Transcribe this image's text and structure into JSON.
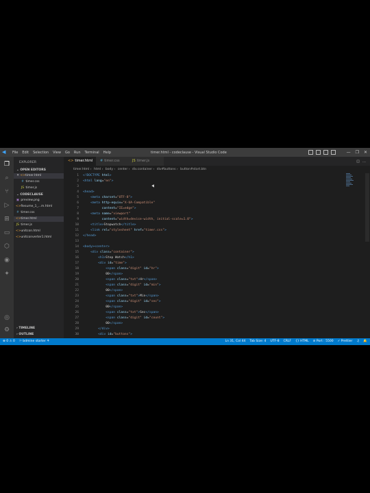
{
  "titlebar": {
    "menu": [
      "File",
      "Edit",
      "Selection",
      "View",
      "Go",
      "Run",
      "Terminal",
      "Help"
    ],
    "title": "timer.html - codeclause - Visual Studio Code",
    "controls": [
      "—",
      "❐",
      "✕"
    ]
  },
  "sidebar": {
    "title": "EXPLORER",
    "open_editors_label": "OPEN EDITORS",
    "open_editors": [
      {
        "name": "timer.html",
        "icon": "html-file-icon",
        "close": "✕"
      },
      {
        "name": "timer.css",
        "icon": "css-file-icon"
      },
      {
        "name": "timer.js",
        "icon": "js-file-icon"
      }
    ],
    "workspace_label": "CODECLAUSE",
    "files": [
      {
        "name": "preview.png",
        "icon": "image-file-icon"
      },
      {
        "name": "Resume_1_...m.html",
        "icon": "html-file-icon"
      },
      {
        "name": "timer.css",
        "icon": "css-file-icon"
      },
      {
        "name": "timer.html",
        "icon": "html-file-icon"
      },
      {
        "name": "timer.js",
        "icon": "js-file-icon"
      },
      {
        "name": "unitcon.html",
        "icon": "html-file-icon"
      },
      {
        "name": "unitconverter1.html",
        "icon": "html-file-icon"
      }
    ],
    "timeline_label": "TIMELINE",
    "outline_label": "OUTLINE"
  },
  "tabs": [
    {
      "label": "timer.html",
      "close": "✕",
      "active": true
    },
    {
      "label": "timer.css",
      "active": false
    },
    {
      "label": "timer.js",
      "active": false
    }
  ],
  "breadcrumb": [
    "timer.html",
    "html",
    "body",
    "center",
    "div.container",
    "div#buttons",
    "button#start.btn"
  ],
  "code_lines": [
    {
      "n": "1",
      "h": "<span class=\"tag\">&lt;!DOCTYPE</span> <span class=\"attr\">html</span><span class=\"tag\">&gt;</span>"
    },
    {
      "n": "2",
      "h": "<span class=\"tag\">&lt;html</span> <span class=\"attr\">lang</span>=<span class=\"str\">\"en\"</span><span class=\"tag\">&gt;</span>"
    },
    {
      "n": "3",
      "h": ""
    },
    {
      "n": "4",
      "h": "<span class=\"tag\">&lt;head&gt;</span>"
    },
    {
      "n": "5",
      "h": "    <span class=\"tag\">&lt;meta</span> <span class=\"attr\">charset</span>=<span class=\"str\">\"UTF-8\"</span><span class=\"tag\">&gt;</span>"
    },
    {
      "n": "6",
      "h": "    <span class=\"tag\">&lt;meta</span> <span class=\"attr\">http-equiv</span>=<span class=\"str\">\"X-UA-Compatible\"</span>"
    },
    {
      "n": "7",
      "h": "          <span class=\"attr\">content</span>=<span class=\"str\">\"IE=edge\"</span><span class=\"tag\">&gt;</span>"
    },
    {
      "n": "8",
      "h": "    <span class=\"tag\">&lt;meta</span> <span class=\"attr\">name</span>=<span class=\"str\">\"viewport\"</span>"
    },
    {
      "n": "9",
      "h": "          <span class=\"attr\">content</span>=<span class=\"str\">\"width=device-width, initial-scale=1.0\"</span><span class=\"tag\">&gt;</span>"
    },
    {
      "n": "10",
      "h": "    <span class=\"tag\">&lt;title&gt;</span><span class=\"txt\">Stopwatch</span><span class=\"tag\">&lt;/title&gt;</span>"
    },
    {
      "n": "11",
      "h": "    <span class=\"tag\">&lt;link</span> <span class=\"attr\">rel</span>=<span class=\"str\">\"stylesheet\"</span> <span class=\"attr\">href</span>=<span class=\"str\">\"timer.css\"</span><span class=\"tag\">&gt;</span>"
    },
    {
      "n": "12",
      "h": "<span class=\"tag\">&lt;/head&gt;</span>"
    },
    {
      "n": "13",
      "h": ""
    },
    {
      "n": "14",
      "h": "<span class=\"tag\">&lt;body&gt;&lt;center&gt;</span>"
    },
    {
      "n": "15",
      "h": "    <span class=\"tag\">&lt;div</span> <span class=\"attr\">class</span>=<span class=\"str\">\"container\"</span><span class=\"tag\">&gt;</span>"
    },
    {
      "n": "16",
      "h": "        <span class=\"tag\">&lt;h1&gt;</span><span class=\"txt\">Stop Watch</span><span class=\"tag\">&lt;/h1&gt;</span>"
    },
    {
      "n": "17",
      "h": "        <span class=\"tag\">&lt;div</span> <span class=\"attr\">id</span>=<span class=\"str\">\"time\"</span><span class=\"tag\">&gt;</span>"
    },
    {
      "n": "18",
      "h": "            <span class=\"tag\">&lt;span</span> <span class=\"attr\">class</span>=<span class=\"str\">\"digit\"</span> <span class=\"attr\">id</span>=<span class=\"str\">\"hr\"</span><span class=\"tag\">&gt;</span>"
    },
    {
      "n": "19",
      "h": "            <span class=\"txt\">00</span><span class=\"tag\">&lt;/span&gt;</span>"
    },
    {
      "n": "20",
      "h": "            <span class=\"tag\">&lt;span</span> <span class=\"attr\">class</span>=<span class=\"str\">\"txt\"</span><span class=\"tag\">&gt;</span><span class=\"txt\">Hr</span><span class=\"tag\">&lt;/span&gt;</span>"
    },
    {
      "n": "21",
      "h": "            <span class=\"tag\">&lt;span</span> <span class=\"attr\">class</span>=<span class=\"str\">\"digit\"</span> <span class=\"attr\">id</span>=<span class=\"str\">\"min\"</span><span class=\"tag\">&gt;</span>"
    },
    {
      "n": "22",
      "h": "            <span class=\"txt\">00</span><span class=\"tag\">&lt;/span&gt;</span>"
    },
    {
      "n": "23",
      "h": "            <span class=\"tag\">&lt;span</span> <span class=\"attr\">class</span>=<span class=\"str\">\"txt\"</span><span class=\"tag\">&gt;</span><span class=\"txt\">Min</span><span class=\"tag\">&lt;/span&gt;</span>"
    },
    {
      "n": "24",
      "h": "            <span class=\"tag\">&lt;span</span> <span class=\"attr\">class</span>=<span class=\"str\">\"digit\"</span> <span class=\"attr\">id</span>=<span class=\"str\">\"sec\"</span><span class=\"tag\">&gt;</span>"
    },
    {
      "n": "25",
      "h": "            <span class=\"txt\">00</span><span class=\"tag\">&lt;/span&gt;</span>"
    },
    {
      "n": "26",
      "h": "            <span class=\"tag\">&lt;span</span> <span class=\"attr\">class</span>=<span class=\"str\">\"txt\"</span><span class=\"tag\">&gt;</span><span class=\"txt\">Sec</span><span class=\"tag\">&lt;/span&gt;</span>"
    },
    {
      "n": "27",
      "h": "            <span class=\"tag\">&lt;span</span> <span class=\"attr\">class</span>=<span class=\"str\">\"digit\"</span> <span class=\"attr\">id</span>=<span class=\"str\">\"count\"</span><span class=\"tag\">&gt;</span>"
    },
    {
      "n": "28",
      "h": "            <span class=\"txt\">00</span><span class=\"tag\">&lt;/span&gt;</span>"
    },
    {
      "n": "29",
      "h": "        <span class=\"tag\">&lt;/div&gt;</span>"
    },
    {
      "n": "30",
      "h": "        <span class=\"tag\">&lt;div</span> <span class=\"attr\">id</span>=<span class=\"str\">\"buttons\"</span><span class=\"tag\">&gt;</span>"
    }
  ],
  "statusbar": {
    "left": [
      "⊗ 0 ⚠ 0",
      "⚐ bdmine starter ⚘"
    ],
    "right": [
      "Ln 31, Col 44",
      "Tab Size: 4",
      "UTF-8",
      "CRLF",
      "{} HTML",
      "⊘ Port : 5500",
      "✓ Prettier",
      "♫",
      "🔔"
    ]
  },
  "colors": {
    "accent": "#007acc",
    "titlebar": "#3c3c3c",
    "editor_bg": "#1e1e1e",
    "sidebar_bg": "#252526"
  }
}
